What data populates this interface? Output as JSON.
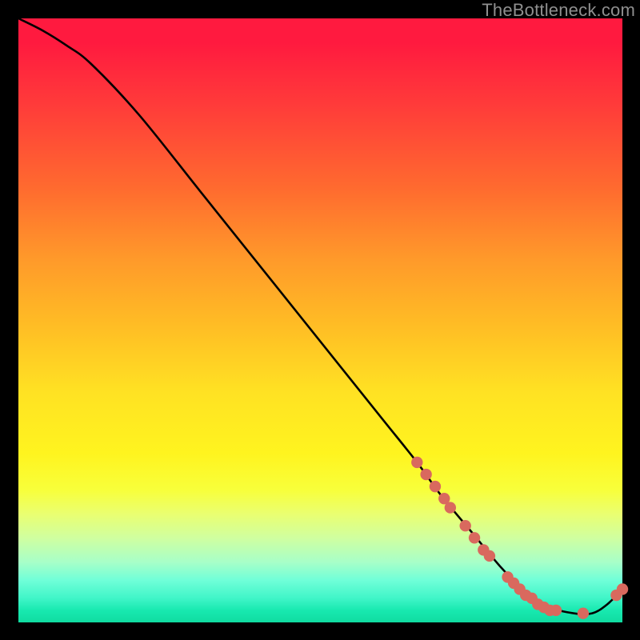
{
  "watermark": "TheBottleneck.com",
  "chart_data": {
    "type": "line",
    "title": "",
    "xlabel": "",
    "ylabel": "",
    "xlim": [
      0,
      100
    ],
    "ylim": [
      0,
      100
    ],
    "series": [
      {
        "name": "curve",
        "x": [
          0,
          4,
          8,
          12,
          20,
          30,
          40,
          50,
          60,
          66,
          70,
          75,
          80,
          84,
          88,
          92,
          95,
          97.5,
          100
        ],
        "y": [
          100,
          98,
          95.5,
          92.5,
          84,
          71.5,
          59,
          46.5,
          34,
          26.5,
          21,
          15,
          9,
          5,
          2.5,
          1.5,
          1.5,
          3,
          5.5
        ]
      }
    ],
    "markers": [
      {
        "x": 66.0,
        "y": 26.5
      },
      {
        "x": 67.5,
        "y": 24.5
      },
      {
        "x": 69.0,
        "y": 22.5
      },
      {
        "x": 70.5,
        "y": 20.5
      },
      {
        "x": 71.5,
        "y": 19.0
      },
      {
        "x": 74.0,
        "y": 16.0
      },
      {
        "x": 75.5,
        "y": 14.0
      },
      {
        "x": 77.0,
        "y": 12.0
      },
      {
        "x": 78.0,
        "y": 11.0
      },
      {
        "x": 81.0,
        "y": 7.5
      },
      {
        "x": 82.0,
        "y": 6.5
      },
      {
        "x": 83.0,
        "y": 5.5
      },
      {
        "x": 84.0,
        "y": 4.5
      },
      {
        "x": 85.0,
        "y": 4.0
      },
      {
        "x": 86.0,
        "y": 3.0
      },
      {
        "x": 87.0,
        "y": 2.5
      },
      {
        "x": 88.0,
        "y": 2.0
      },
      {
        "x": 89.0,
        "y": 2.0
      },
      {
        "x": 93.5,
        "y": 1.5
      },
      {
        "x": 99.0,
        "y": 4.5
      },
      {
        "x": 100.0,
        "y": 5.5
      }
    ],
    "gradient_stops": [
      {
        "pos": 0,
        "color": "#ff1a3f"
      },
      {
        "pos": 14,
        "color": "#ff3a3a"
      },
      {
        "pos": 28,
        "color": "#ff6a2f"
      },
      {
        "pos": 40,
        "color": "#ff9a2a"
      },
      {
        "pos": 50,
        "color": "#ffba25"
      },
      {
        "pos": 62,
        "color": "#ffe223"
      },
      {
        "pos": 72,
        "color": "#fff41f"
      },
      {
        "pos": 82,
        "color": "#eaff70"
      },
      {
        "pos": 90,
        "color": "#a8ffc8"
      },
      {
        "pos": 96,
        "color": "#40f5c8"
      },
      {
        "pos": 100,
        "color": "#10dca0"
      }
    ],
    "colors": {
      "curve": "#000000",
      "marker_fill": "#d9695e",
      "marker_stroke": "#d9695e",
      "background_outer": "#000000"
    }
  }
}
